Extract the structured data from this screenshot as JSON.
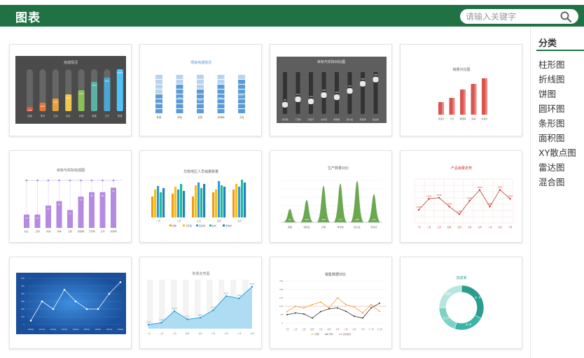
{
  "header": {
    "title": "图表",
    "search_placeholder": "请输入关键字",
    "bg": "#207245"
  },
  "sidebar": {
    "title": "分类",
    "items": [
      {
        "label": "柱形图"
      },
      {
        "label": "折线图"
      },
      {
        "label": "饼图"
      },
      {
        "label": "圆环图"
      },
      {
        "label": "条形图"
      },
      {
        "label": "面积图"
      },
      {
        "label": "XY散点图"
      },
      {
        "label": "雷达图"
      },
      {
        "label": "混合图"
      }
    ]
  },
  "cards": [
    {
      "title": "完成情况",
      "categories": [
        "张晨",
        "李芳",
        "王伟",
        "赵红",
        "孙明",
        "周雷",
        "王尔",
        "陈登"
      ],
      "values": [
        10,
        20,
        30,
        40,
        50,
        70,
        80,
        100
      ]
    },
    {
      "title": "项目完成情况",
      "categories": [
        "陈雄",
        "李瑶",
        "赵阳",
        "张海明",
        "王培"
      ],
      "values": [
        50,
        75,
        65,
        80,
        85
      ]
    },
    {
      "title": "目标与实际对比图",
      "categories": [
        "张可能",
        "丁佳鸣",
        "武易平",
        "文卓燕",
        "杨惠香",
        "徐大发",
        "景菜桥",
        "段运春"
      ]
    },
    {
      "title": "销量对比图",
      "categories": [
        "张建杰",
        "王可",
        "戴明丽",
        "陈静",
        "张嘉华"
      ]
    },
    {
      "title": "目标与实际完成图",
      "categories": [
        "赵兰",
        "王明",
        "刘满",
        "孙林",
        "王伟",
        "张建明",
        "王可明",
        "王华",
        "张家明"
      ],
      "values": [
        30,
        30,
        50,
        60,
        40,
        70,
        80,
        80,
        90
      ]
    },
    {
      "title": "华南地区人员销量数量",
      "categories": [
        "一月",
        "二月",
        "三月",
        "四月",
        "五月"
      ],
      "legend": [
        "张敏",
        "王晓丽",
        "陈建明",
        "赵凯",
        "黄浩然"
      ]
    },
    {
      "title": "生产数量对比",
      "categories": [
        "黄振",
        "张晓亮",
        "王明",
        "李可明",
        "陈大宝",
        "张可欣"
      ],
      "values": [
        60,
        100,
        163,
        173,
        185,
        125
      ]
    },
    {
      "title": "产品销量走势",
      "categories": [
        "一月",
        "二月",
        "三月",
        "四月",
        "五月",
        "六月",
        "七月",
        "八月",
        "九月",
        "十月"
      ],
      "values": [
        1420,
        1520,
        1530,
        1450,
        1380,
        1500,
        1600,
        1450,
        1601,
        1520
      ]
    },
    {
      "title": "",
      "values": [
        50,
        300,
        200,
        450,
        300,
        200,
        200,
        400,
        550
      ]
    },
    {
      "title": "数量走势图",
      "categories": [
        "一月",
        "二月",
        "三月",
        "四月",
        "五月",
        "六月",
        "七月",
        "八月",
        "九月"
      ],
      "values": [
        1243,
        1360,
        2074,
        1575,
        1665,
        2132,
        2997,
        2856,
        3567
      ]
    },
    {
      "title": "销售数据对比",
      "categories": [
        "一月",
        "二月",
        "三月",
        "四月",
        "五月",
        "六月",
        "七月",
        "八月",
        "九月",
        "十月",
        "十一月",
        "十二月"
      ],
      "legend": [
        "张明",
        "李军",
        "完成目标"
      ]
    },
    {
      "title": "完成率",
      "values": [
        "第一季",
        "第二季",
        "第三季",
        "第四季"
      ]
    }
  ]
}
